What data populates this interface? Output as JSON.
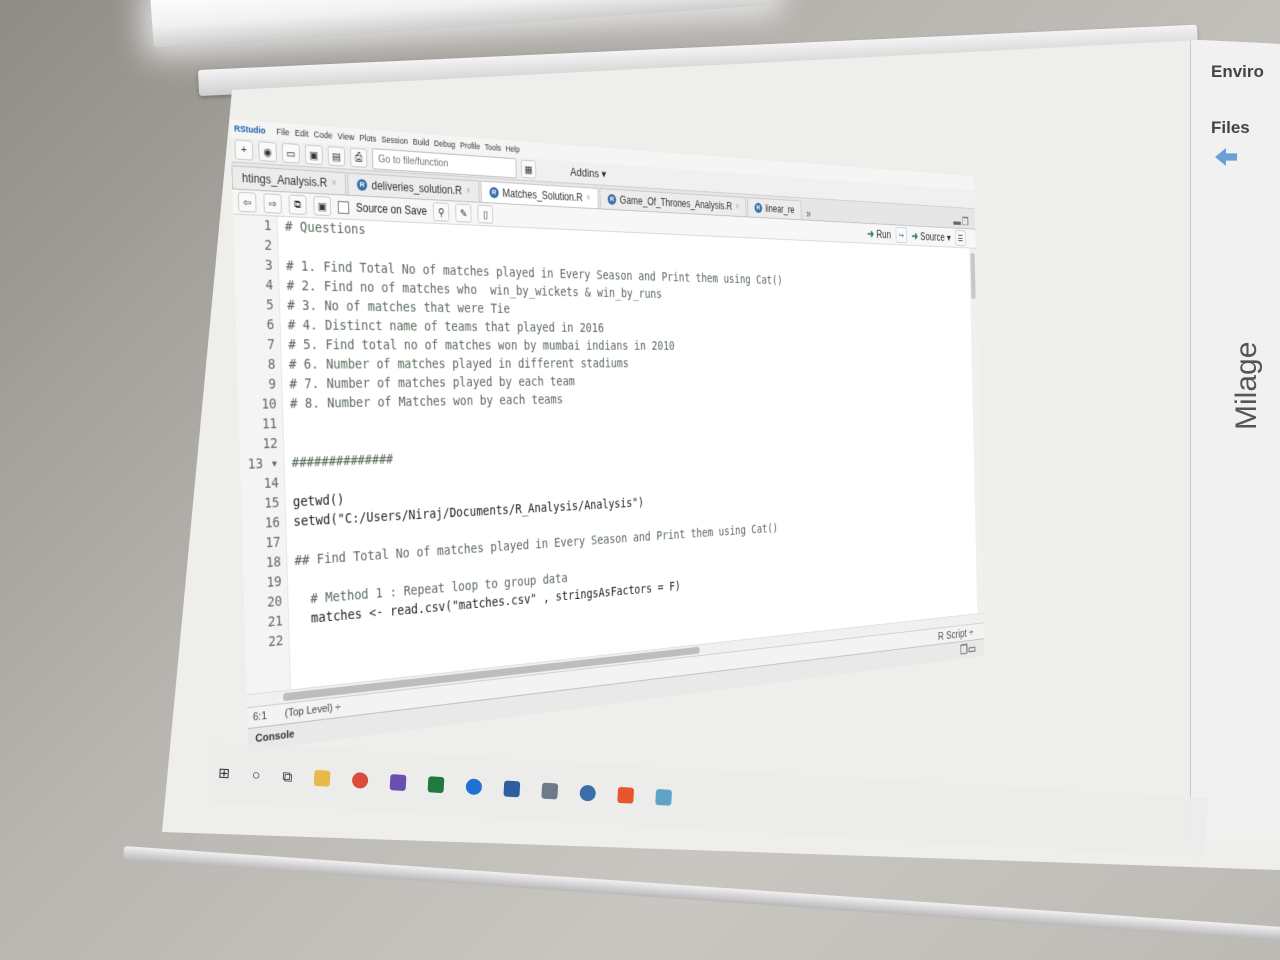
{
  "menu": {
    "app_title": "RStudio",
    "items": [
      "File",
      "Edit",
      "Code",
      "View",
      "Plots",
      "Session",
      "Build",
      "Debug",
      "Profile",
      "Tools",
      "Help"
    ]
  },
  "toolbar": {
    "goto_placeholder": "Go to file/function",
    "addins_label": "Addins ▾"
  },
  "tabs": [
    {
      "label": "htings_Analysis.R",
      "active": false
    },
    {
      "label": "deliveries_solution.R",
      "active": false
    },
    {
      "label": "Matches_Solution.R",
      "active": true
    },
    {
      "label": "Game_Of_Thrones_Analysis.R",
      "active": false
    },
    {
      "label": "linear_re",
      "active": false
    }
  ],
  "editor_toolbar": {
    "source_on_save": "Source on Save",
    "run_label": "Run",
    "source_label": "Source"
  },
  "code": {
    "line_numbers": [
      "1",
      "2",
      "3",
      "4",
      "5",
      "6",
      "7",
      "8",
      "9",
      "10",
      "11",
      "12",
      "13 ▾",
      "14",
      "15",
      "16",
      "17",
      "18",
      "19",
      "20",
      "21",
      "22"
    ],
    "lines": [
      "# Questions",
      "",
      "# 1. Find Total No of matches played in Every Season and Print them using Cat()",
      "# 2. Find no of matches who  win_by_wickets & win_by_runs",
      "# 3. No of matches that were Tie",
      "# 4. Distinct name of teams that played in 2016",
      "# 5. Find total no of matches won by mumbai indians in 2010",
      "# 6. Number of matches played in different stadiums",
      "# 7. Number of matches played by each team",
      "# 8. Number of Matches won by each teams",
      "",
      "",
      "##############",
      "",
      "getwd()",
      "setwd(\"C:/Users/Niraj/Documents/R_Analysis/Analysis\")",
      "",
      "## Find Total No of matches played in Every Season and Print them using Cat()",
      "",
      "  # Method 1 : Repeat loop to group data",
      "  matches <- read.csv(\"matches.csv\" , stringsAsFactors = F)",
      ""
    ]
  },
  "status": {
    "position": "6:1",
    "scope": "(Top Level) ÷",
    "file_type": "R Script ÷"
  },
  "console": {
    "label": "Console"
  },
  "right_pane": {
    "env_tab": "Enviro",
    "files_tab": "Files"
  },
  "wall_text": "Milage"
}
